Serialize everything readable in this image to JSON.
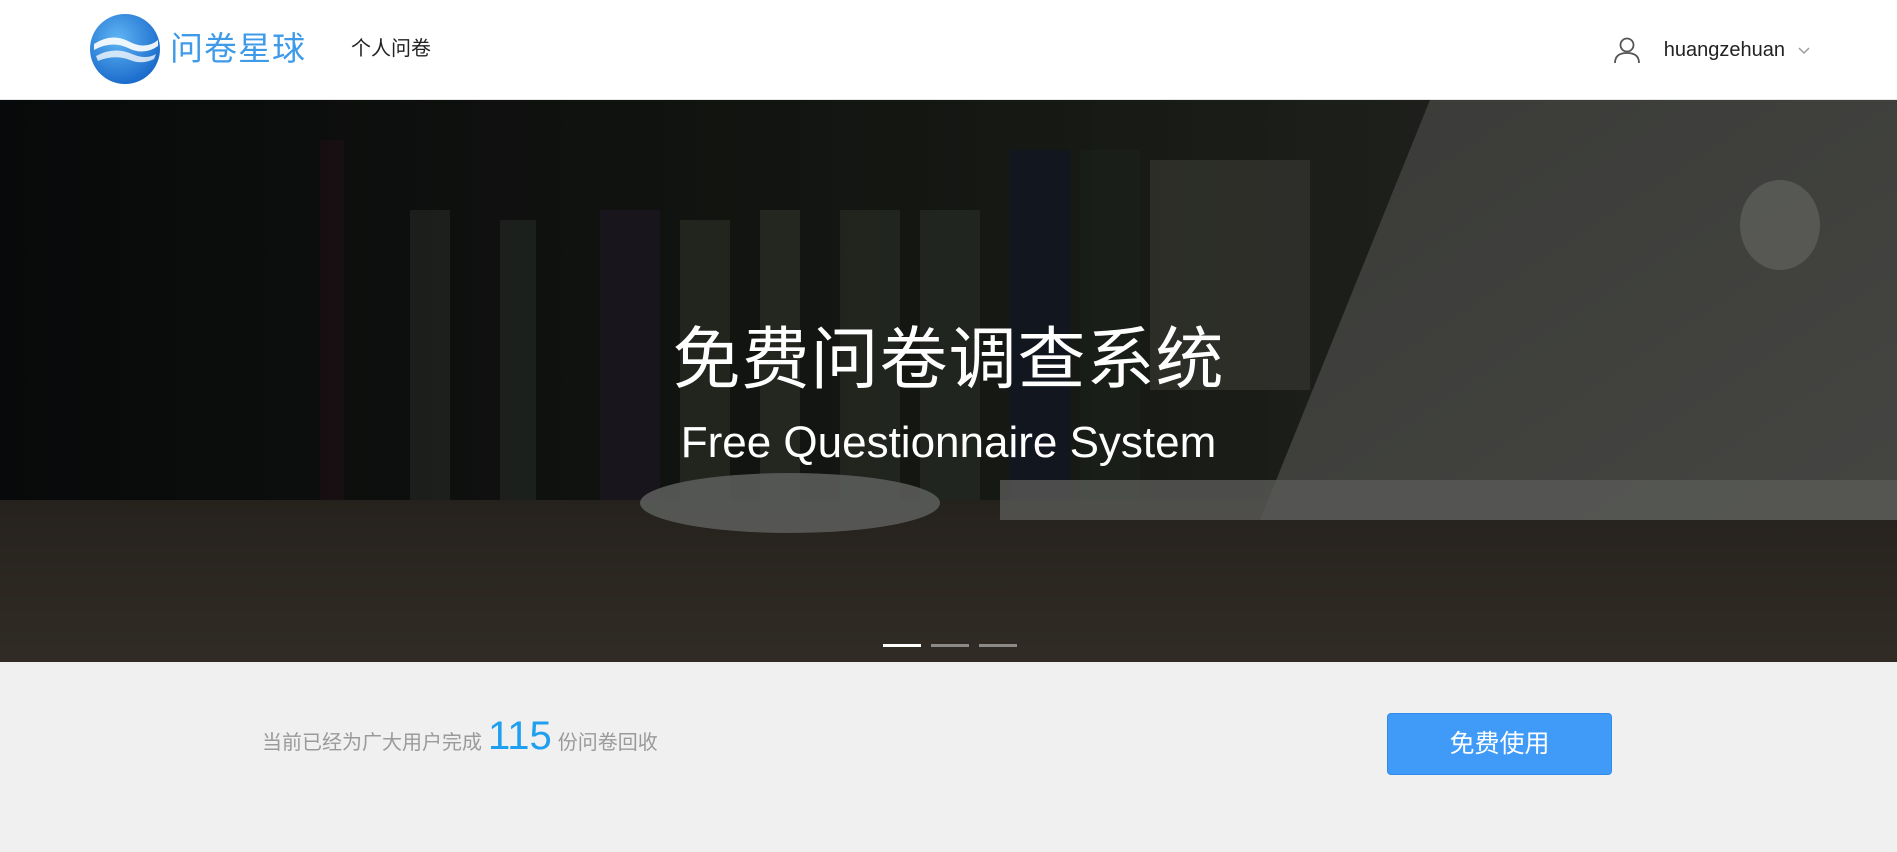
{
  "header": {
    "brand": "问卷星球",
    "nav_link": "个人问卷",
    "username": "huangzehuan",
    "icons": [
      "planet-logo-icon",
      "user-icon",
      "chevron-down-icon"
    ]
  },
  "hero": {
    "title": "免费问卷调查系统",
    "subtitle": "Free Questionnaire System",
    "slides": 3,
    "active_slide": 1
  },
  "stats": {
    "prefix": "当前已经为广大用户完成",
    "count": "115",
    "suffix": "份问卷回收"
  },
  "cta": {
    "label": "免费使用"
  },
  "colors": {
    "brand": "#3f9be8",
    "accent": "#3f9bf7",
    "count": "#1f9ff0",
    "muted": "#9a9a9a"
  }
}
